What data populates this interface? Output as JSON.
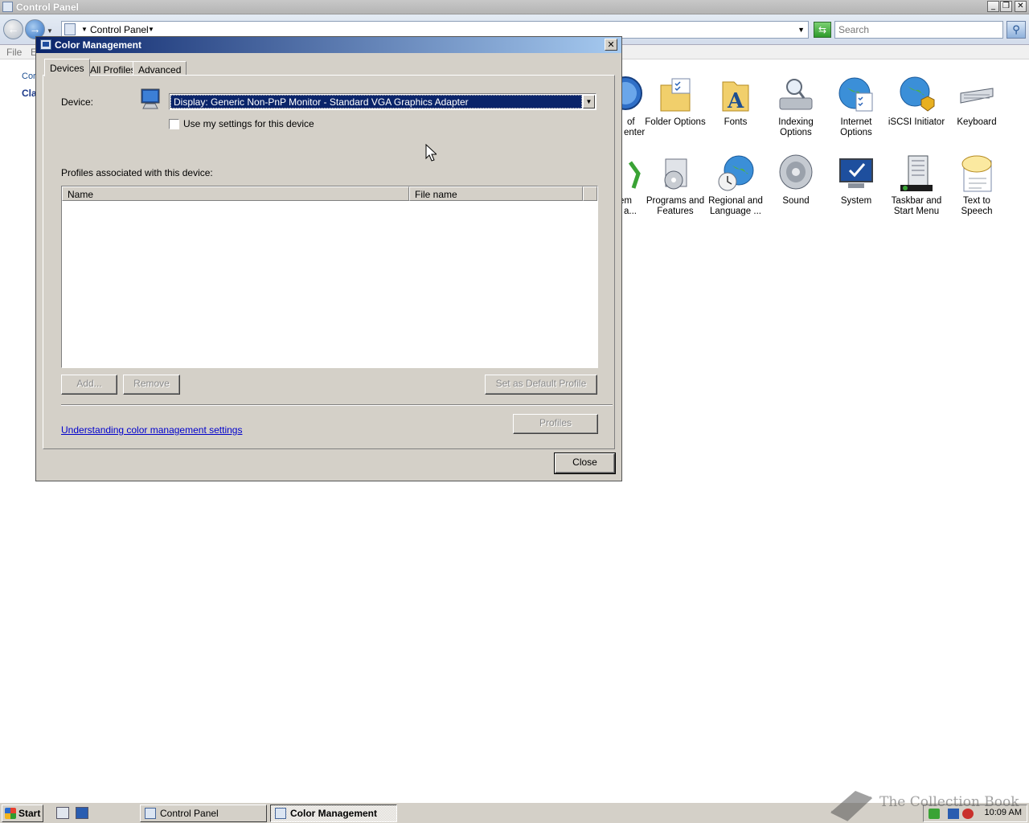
{
  "control_panel": {
    "title": "Control Panel",
    "address": "Control Panel",
    "search_placeholder": "Search",
    "menu": {
      "file": "File",
      "edit": "E"
    },
    "left_links": {
      "link1": "Cor",
      "link2": "Cla"
    },
    "items": [
      {
        "label_line1": "of",
        "label_line2": "enter",
        "icon": "action-center-icon"
      },
      {
        "label_line1": "Folder Options",
        "label_line2": "",
        "icon": "folder-options-icon"
      },
      {
        "label_line1": "Fonts",
        "label_line2": "",
        "icon": "fonts-icon"
      },
      {
        "label_line1": "Indexing",
        "label_line2": "Options",
        "icon": "indexing-options-icon"
      },
      {
        "label_line1": "Internet",
        "label_line2": "Options",
        "icon": "internet-options-icon"
      },
      {
        "label_line1": "iSCSI Initiator",
        "label_line2": "",
        "icon": "iscsi-initiator-icon"
      },
      {
        "label_line1": "Keyboard",
        "label_line2": "",
        "icon": "keyboard-icon"
      },
      {
        "label_line1": "em",
        "label_line2": "a...",
        "icon": "problem-reports-icon"
      },
      {
        "label_line1": "Programs and",
        "label_line2": "Features",
        "icon": "programs-and-features-icon"
      },
      {
        "label_line1": "Regional and",
        "label_line2": "Language ...",
        "icon": "regional-language-icon"
      },
      {
        "label_line1": "Sound",
        "label_line2": "",
        "icon": "sound-icon"
      },
      {
        "label_line1": "System",
        "label_line2": "",
        "icon": "system-icon"
      },
      {
        "label_line1": "Taskbar and",
        "label_line2": "Start Menu",
        "icon": "taskbar-start-menu-icon"
      },
      {
        "label_line1": "Text to",
        "label_line2": "Speech",
        "icon": "text-to-speech-icon"
      }
    ]
  },
  "dialog": {
    "title": "Color Management",
    "close_x": "✕",
    "tabs": {
      "devices": "Devices",
      "all_profiles": "All Profiles",
      "advanced": "Advanced"
    },
    "device_label": "Device:",
    "device_value": "Display: Generic Non-PnP Monitor - Standard VGA Graphics Adapter",
    "use_settings_label": "Use my settings for this device",
    "use_settings_checked": false,
    "profiles_label": "Profiles associated with this device:",
    "columns": {
      "name": "Name",
      "file_name": "File name"
    },
    "rows": [],
    "buttons": {
      "add": "Add...",
      "remove": "Remove",
      "set_default": "Set as Default Profile",
      "profiles": "Profiles",
      "close": "Close"
    },
    "link": "Understanding color management settings"
  },
  "taskbar": {
    "start": "Start",
    "tasks": {
      "control_panel": "Control Panel",
      "color_management": "Color Management"
    },
    "clock": "10:09 AM"
  },
  "watermark": "The Collection Book"
}
